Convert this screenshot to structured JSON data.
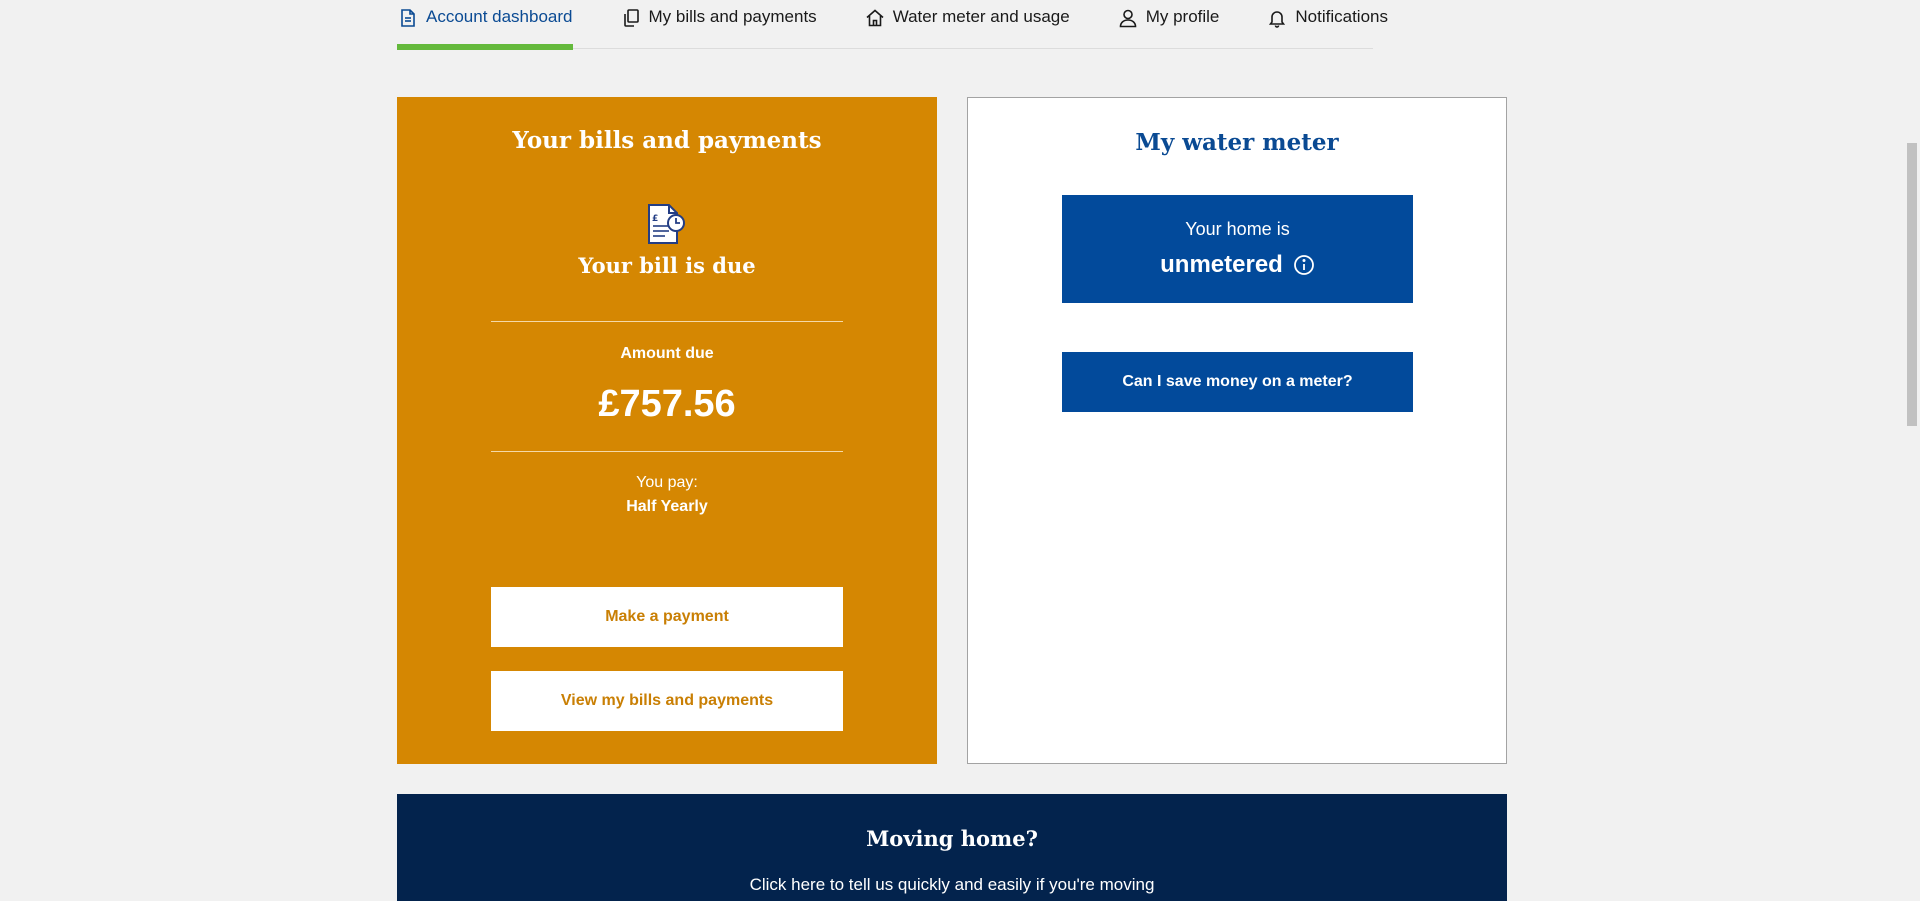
{
  "tabs": [
    {
      "label": "Account dashboard",
      "icon": "document-icon",
      "active": true
    },
    {
      "label": "My bills and payments",
      "icon": "copy-icon",
      "active": false
    },
    {
      "label": "Water meter and usage",
      "icon": "home-icon",
      "active": false
    },
    {
      "label": "My profile",
      "icon": "user-icon",
      "active": false
    },
    {
      "label": "Notifications",
      "icon": "bell-icon",
      "active": false
    }
  ],
  "bills_card": {
    "title": "Your bills and payments",
    "icon": "bill-document-icon",
    "status": "Your bill is due",
    "amount_label": "Amount due",
    "amount": "£757.56",
    "pay_label": "You pay:",
    "pay_frequency": "Half Yearly",
    "make_payment_label": "Make a payment",
    "view_bills_label": "View my bills and payments"
  },
  "meter_card": {
    "title": "My water meter",
    "line1": "Your home is",
    "status": "unmetered",
    "info_icon": "info-icon",
    "save_money_label": "Can I save money on a meter?"
  },
  "moving_banner": {
    "title": "Moving home?",
    "text": "Click here to tell us quickly and easily if you're moving"
  },
  "colors": {
    "bills_card_bg": "#d58702",
    "meter_blue": "#024a9b",
    "banner_navy": "#03234d",
    "active_tab_underline": "#64b93c",
    "active_tab_text": "#0a4a93"
  }
}
